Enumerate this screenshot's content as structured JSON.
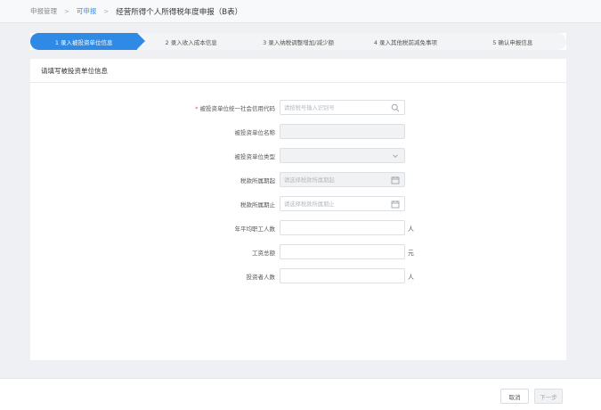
{
  "breadcrumb": {
    "item1": "申报管理",
    "item2": "可申报",
    "current": "经营所得个人所得税年度申报（B表）"
  },
  "steps": [
    "1 录入被投资单位信息",
    "2 录入收入成本信息",
    "3 录入纳税调整增加/减少额",
    "4 录入其他税前减免事项",
    "5 确认申报信息"
  ],
  "panel": {
    "title": "请填写被投资单位信息"
  },
  "form": {
    "credit_code": {
      "label": "被投资单位统一社会信用代码",
      "placeholder": "请按税号输入识别号"
    },
    "unit_name": {
      "label": "被投资单位名称",
      "value": ""
    },
    "unit_type": {
      "label": "被投资单位类型",
      "value": ""
    },
    "period_start": {
      "label": "税款所属期起",
      "placeholder": "请选择税款所属期起"
    },
    "period_end": {
      "label": "税款所属期止",
      "placeholder": "请选择税款所属期止"
    },
    "avg_employees": {
      "label": "年平均职工人数",
      "unit": "人"
    },
    "total_wages": {
      "label": "工资总额",
      "unit": "元"
    },
    "investor_count": {
      "label": "投资者人数",
      "unit": "人"
    }
  },
  "footer": {
    "cancel": "取消",
    "next": "下一步"
  }
}
